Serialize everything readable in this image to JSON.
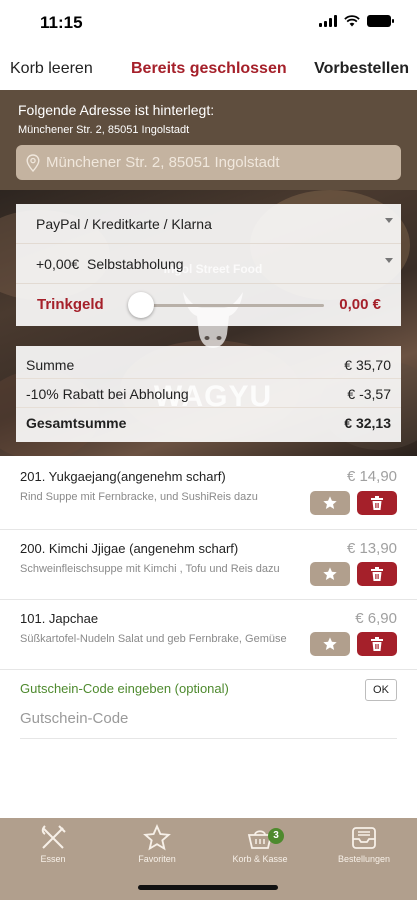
{
  "status_bar": {
    "time": "11:15"
  },
  "nav": {
    "clear_cart": "Korb leeren",
    "status": "Bereits geschlossen",
    "preorder": "Vorbestellen"
  },
  "address": {
    "heading": "Folgende Adresse ist hinterlegt:",
    "value": "Münchener Str. 2, 85051 Ingolstadt",
    "field_value": "Münchener Str. 2, 85051 Ingolstadt"
  },
  "payment": {
    "method": "PayPal / Kreditkarte / Klarna",
    "delivery_fee": "+0,00€",
    "delivery_mode": "Selbstabholung",
    "tip_label": "Trinkgeld",
    "tip_value": "0,00 €",
    "tip_fraction": 0
  },
  "background_logo": {
    "heading": "Ingol Street Food",
    "name": "WAGYU"
  },
  "summary": {
    "rows": [
      {
        "label": "Summe",
        "value": "€ 35,70"
      },
      {
        "label": "-10% Rabatt bei Abholung",
        "value": "€ -3,57"
      },
      {
        "label": "Gesamtsumme",
        "value": "€ 32,13"
      }
    ]
  },
  "cart_items": [
    {
      "name": "201. Yukgaejang(angenehm scharf)",
      "desc": "Rind Suppe mit Fernbracke, und SushiReis dazu",
      "price": "€ 14,90"
    },
    {
      "name": "200. Kimchi Jjigae (angenehm scharf)",
      "desc": "Schweinfleischsuppe mit Kimchi , Tofu und Reis dazu",
      "price": "€ 13,90"
    },
    {
      "name": "101. Japchae",
      "desc": "Süßkartofel-Nudeln Salat und geb Fernbrake, Gemüse",
      "price": "€ 6,90"
    }
  ],
  "voucher": {
    "label": "Gutschein-Code eingeben (optional)",
    "ok": "OK",
    "placeholder": "Gutschein-Code"
  },
  "tabs": [
    {
      "label": "Essen",
      "icon": "fork-knife-icon"
    },
    {
      "label": "Favoriten",
      "icon": "star-icon"
    },
    {
      "label": "Korb & Kasse",
      "icon": "basket-icon",
      "badge": "3"
    },
    {
      "label": "Bestellungen",
      "icon": "inbox-icon"
    }
  ],
  "colors": {
    "accent_red": "#a5202a",
    "brown": "#5f4e3e",
    "tab_bar": "#b19f8d",
    "green": "#4e8a2e"
  }
}
